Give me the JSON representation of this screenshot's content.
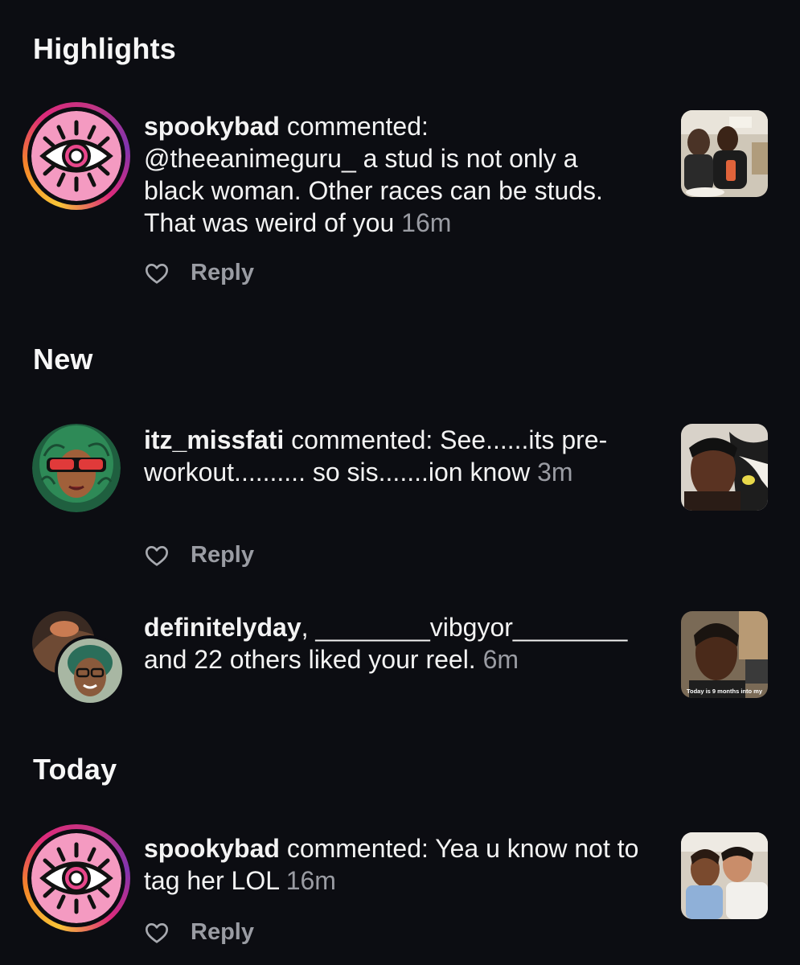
{
  "sections": {
    "highlights": "Highlights",
    "new": "New",
    "today": "Today"
  },
  "notifications": [
    {
      "username": "spookybad",
      "text": " commented: @theeanimeguru_ a stud is not only a black woman. Other races can be studs. That was weird of you ",
      "time": "16m",
      "reply": "Reply"
    },
    {
      "username": "itz_missfati",
      "text": " commented: See......its pre-workout.......... so sis.......ion know ",
      "time": "3m",
      "reply": "Reply"
    },
    {
      "username": "definitelyday",
      "text": ", ________vibgyor________ and 22 others liked your reel. ",
      "time": "6m",
      "thumb_caption": "Today is 9 months into my"
    },
    {
      "username": "spookybad",
      "text": " commented: Yea u know not to tag her LOL ",
      "time": "16m",
      "reply": "Reply"
    }
  ],
  "icons": {
    "heart": "heart-outline-icon",
    "eye_avatar": "eye-logo"
  },
  "colors": {
    "background": "#0c0d12",
    "secondary_text": "#9a9ca3",
    "avatar_pink": "#f49ac1",
    "ring_start": "#f8c537",
    "ring_end": "#c13584"
  }
}
